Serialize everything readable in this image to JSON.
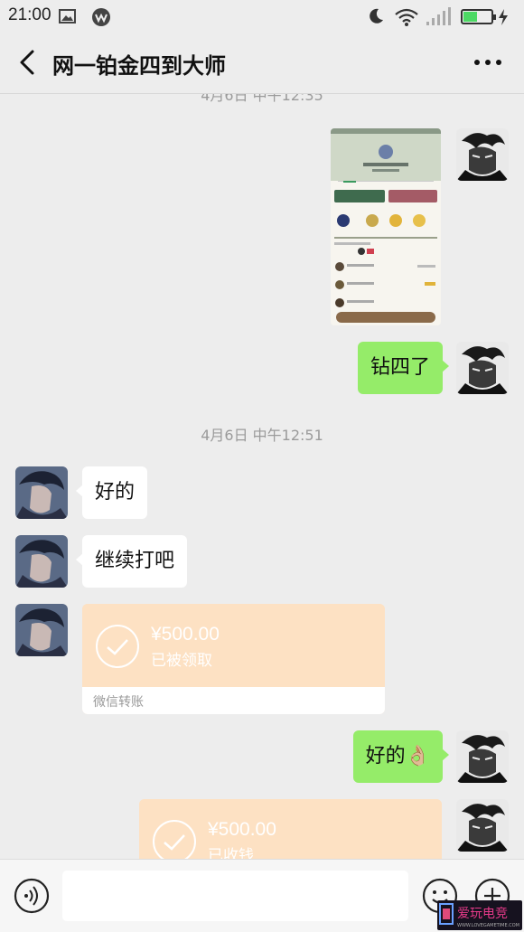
{
  "status_bar": {
    "time": "21:00"
  },
  "header": {
    "title": "网一铂金四到大师"
  },
  "timestamps": [
    "4月6日 中午12:35",
    "4月6日 中午12:51"
  ],
  "messages": [
    {
      "side": "right",
      "type": "image"
    },
    {
      "side": "right",
      "type": "text",
      "text": "钻四了"
    },
    {
      "side": "left",
      "type": "text",
      "text": "好的"
    },
    {
      "side": "left",
      "type": "text",
      "text": "继续打吧"
    },
    {
      "side": "left",
      "type": "transfer",
      "amount": "¥500.00",
      "status": "已被领取",
      "footer": "微信转账"
    },
    {
      "side": "right",
      "type": "text",
      "text": "好的👌🏼"
    },
    {
      "side": "right",
      "type": "transfer",
      "amount": "¥500.00",
      "status": "已收钱"
    }
  ],
  "watermark": {
    "text": "爱玩电竞",
    "subtext": "WWW.LOVEGAMETIME.COM"
  },
  "colors": {
    "background": "#ededed",
    "bubble_sent": "#95ec69",
    "bubble_received": "#ffffff",
    "transfer_card": "#fde1c3"
  },
  "icons": [
    "image-icon",
    "weibo-icon",
    "moon-icon",
    "wifi-icon",
    "signal-icon",
    "battery-icon",
    "back-arrow-icon",
    "more-icon",
    "voice-icon",
    "emoji-icon",
    "plus-icon"
  ]
}
